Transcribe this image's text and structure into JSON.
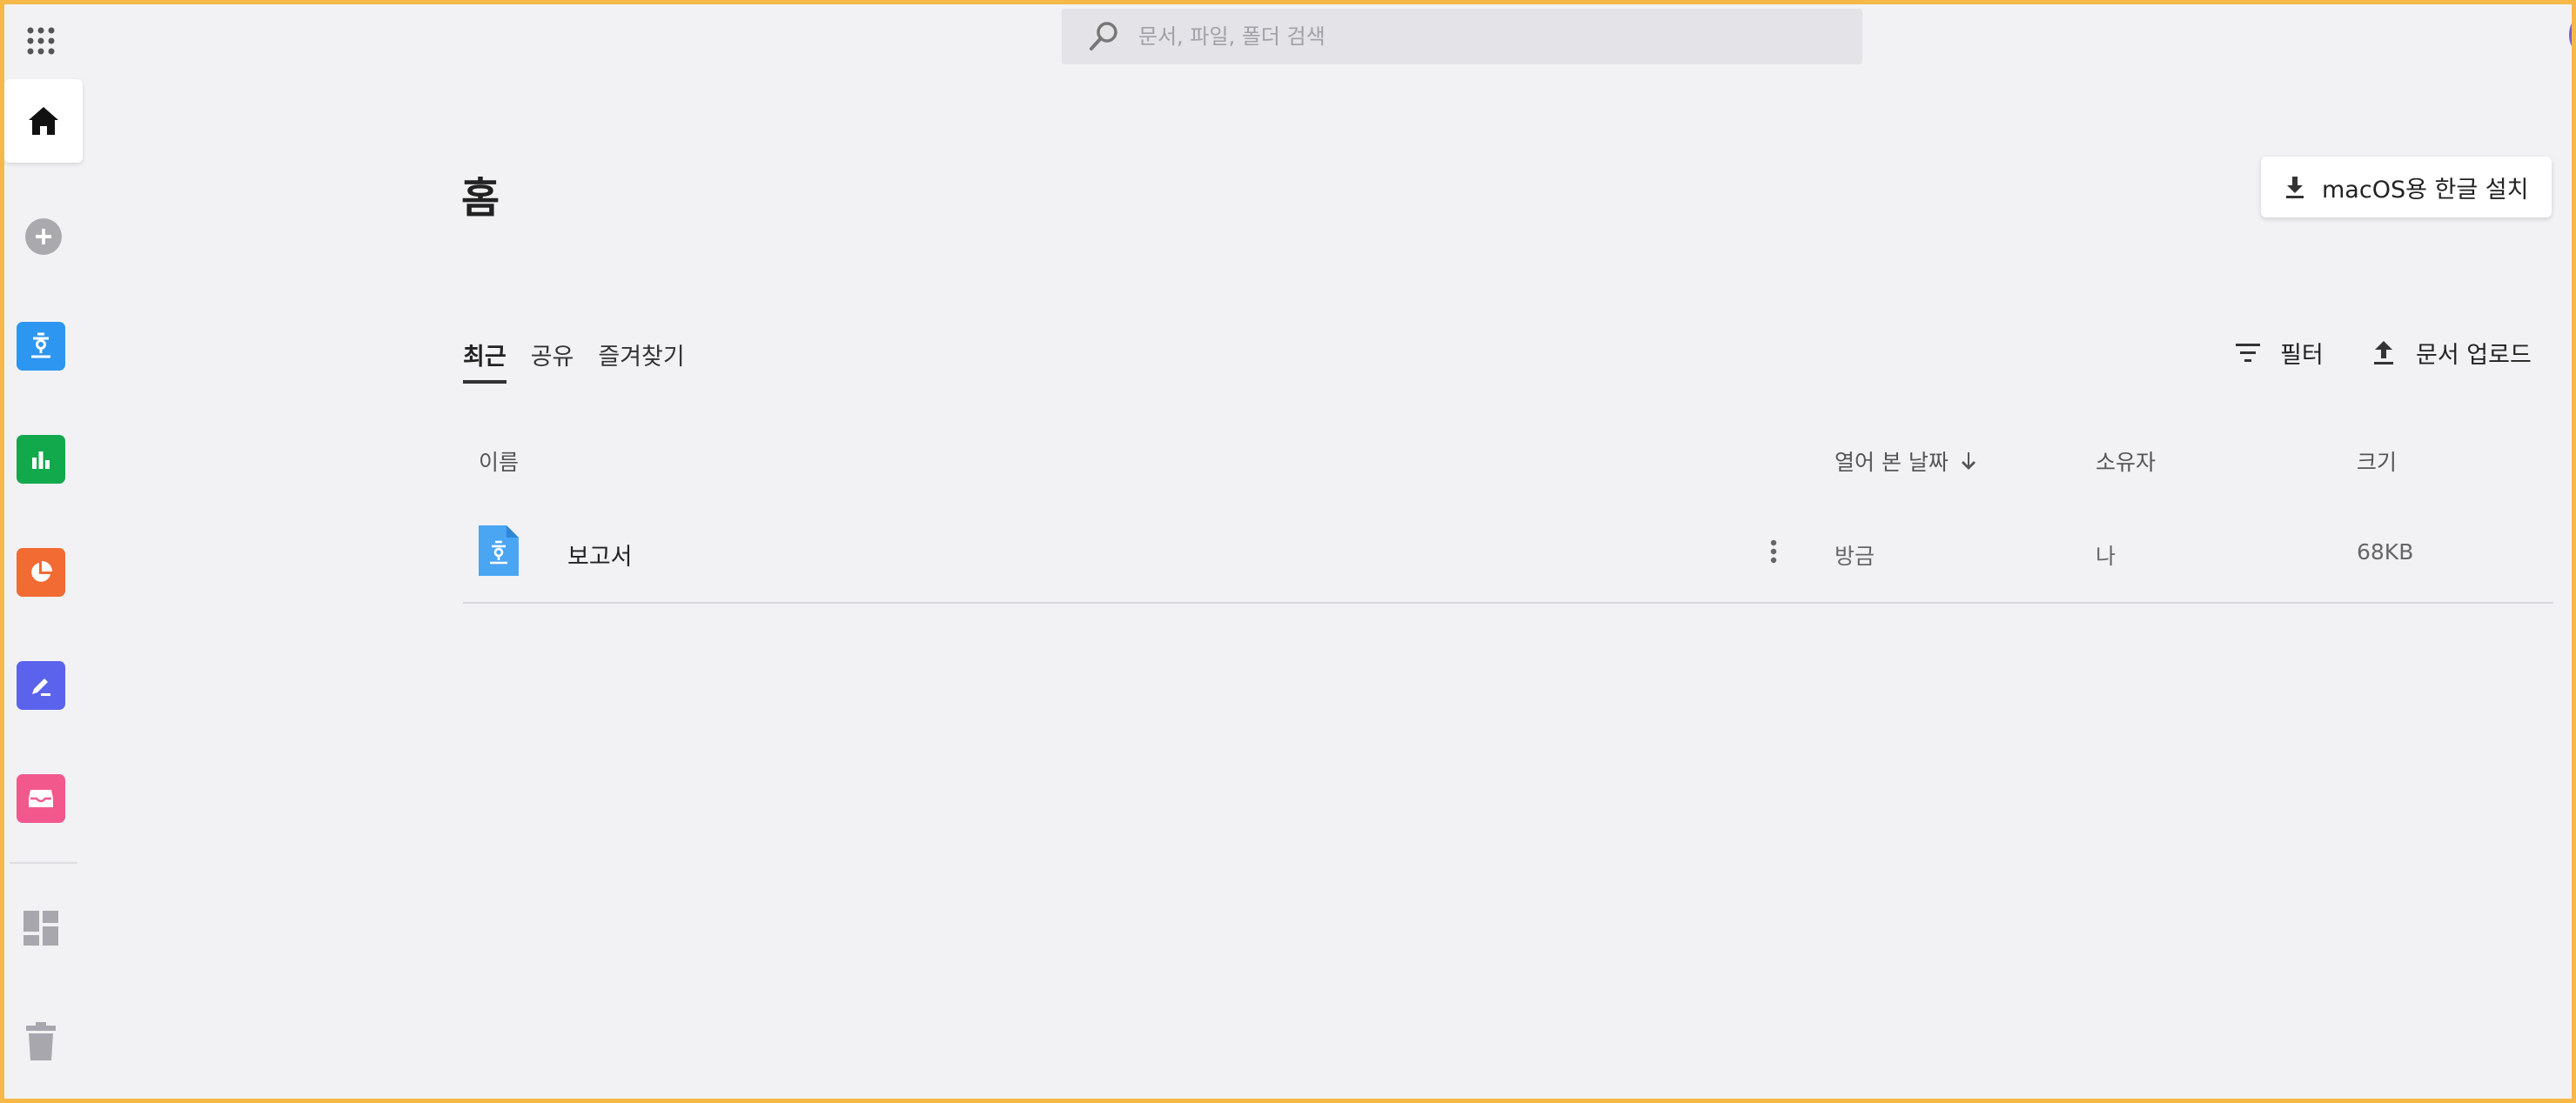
{
  "search": {
    "placeholder": "문서, 파일, 폴더 검색"
  },
  "page": {
    "title": "홈"
  },
  "install_button": {
    "label": "macOS용 한글 설치"
  },
  "tabs": [
    {
      "label": "최근",
      "active": true
    },
    {
      "label": "공유",
      "active": false
    },
    {
      "label": "즐겨찾기",
      "active": false
    }
  ],
  "actions": {
    "filter_label": "필터",
    "upload_label": "문서 업로드"
  },
  "table": {
    "columns": {
      "name": "이름",
      "opened": "열어 본 날짜",
      "owner": "소유자",
      "size": "크기"
    },
    "rows": [
      {
        "name": "보고서",
        "opened": "방금",
        "owner": "나",
        "size": "68KB",
        "type_icon": "hangul-doc-icon"
      }
    ]
  },
  "sidebar": {
    "items": [
      {
        "icon": "apps-grid-icon"
      },
      {
        "icon": "home-icon",
        "active": true
      },
      {
        "icon": "plus-circle-icon"
      },
      {
        "icon": "hangul-doc-icon",
        "color": "#2d96f0"
      },
      {
        "icon": "hancell-chart-icon",
        "color": "#12a84c"
      },
      {
        "icon": "hanshow-pie-icon",
        "color": "#f16b33"
      },
      {
        "icon": "pen-icon",
        "color": "#5b62ec"
      },
      {
        "icon": "inbox-icon",
        "color": "#f2588c"
      },
      {
        "icon": "dashboard-icon"
      },
      {
        "icon": "trash-icon"
      }
    ]
  },
  "colors": {
    "frame": "#f7b84a",
    "background": "#f2f2f5"
  }
}
